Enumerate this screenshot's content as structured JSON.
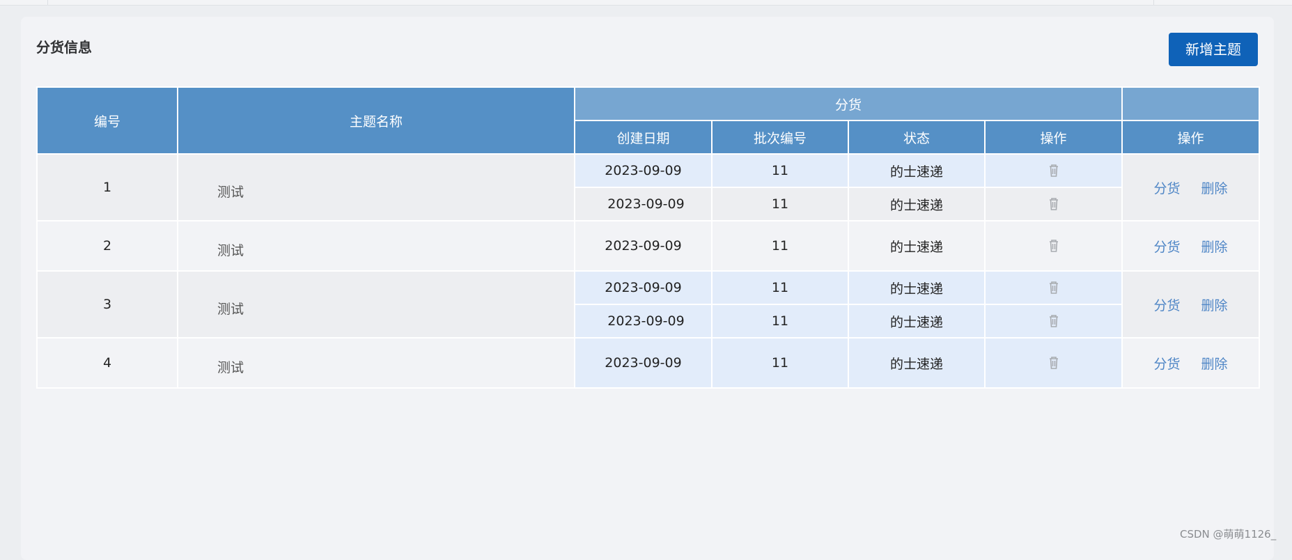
{
  "page": {
    "title": "分货信息",
    "add_button_label": "新增主题",
    "watermark": "CSDN @萌萌1126_"
  },
  "table": {
    "headers": {
      "id": "编号",
      "topic_name": "主题名称",
      "group": "分货",
      "created_date": "创建日期",
      "batch_no": "批次编号",
      "status": "状态",
      "sub_action": "操作",
      "action": "操作"
    },
    "rows": [
      {
        "id": "1",
        "topic_name": "测试",
        "shipments": [
          {
            "created_date": "2023-09-09",
            "batch_no": "11",
            "status": "的士速递"
          },
          {
            "created_date": "2023-09-09",
            "batch_no": "11",
            "status": "的士速递"
          }
        ],
        "actions": [
          "分货",
          "删除"
        ]
      },
      {
        "id": "2",
        "topic_name": "测试",
        "shipments": [
          {
            "created_date": "2023-09-09",
            "batch_no": "11",
            "status": "的士速递"
          }
        ],
        "actions": [
          "分货",
          "删除"
        ]
      },
      {
        "id": "3",
        "topic_name": "测试",
        "shipments": [
          {
            "created_date": "2023-09-09",
            "batch_no": "11",
            "status": "的士速递"
          },
          {
            "created_date": "2023-09-09",
            "batch_no": "11",
            "status": "的士速递"
          }
        ],
        "actions": [
          "分货",
          "删除"
        ]
      },
      {
        "id": "4",
        "topic_name": "测试",
        "shipments": [
          {
            "created_date": "2023-09-09",
            "batch_no": "11",
            "status": "的士速递"
          }
        ],
        "actions": [
          "分货",
          "删除"
        ]
      }
    ]
  },
  "icons": {
    "row_delete": "trash-icon"
  },
  "colors": {
    "header": "#5590c6",
    "group_header": "#77a6d1",
    "primary_button": "#0f62b8",
    "link": "#4f86c6",
    "highlight_row": "#e2ecfa"
  }
}
